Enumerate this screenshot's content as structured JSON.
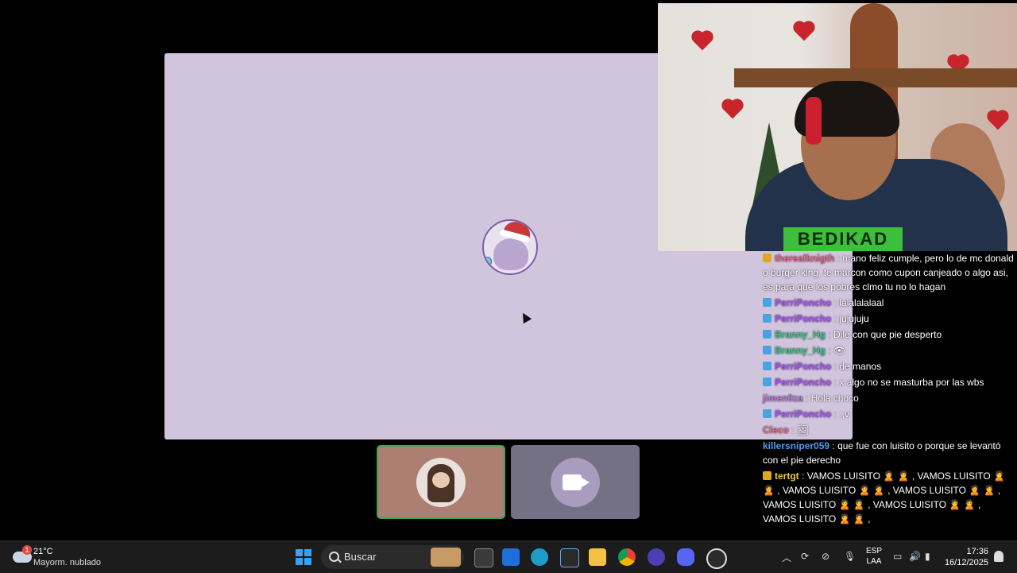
{
  "chat": {
    "messages": [
      {
        "user": "therealknigth",
        "user_color": "#e0688c",
        "badge": "gold",
        "text": "mano feliz cumple, pero lo de mc donald o burger king, te marcon como cupon canjeado o algo asi, es para que los pobres clmo tu no lo hagan"
      },
      {
        "user": "PerriPoncho",
        "user_color": "#a855f7",
        "badge": "blue",
        "text": "lalalalalaal"
      },
      {
        "user": "PerriPoncho",
        "user_color": "#a855f7",
        "badge": "blue",
        "text": "jujujuju"
      },
      {
        "user": "Branny_Hg",
        "user_color": "#3ec58a",
        "badge": "blue",
        "text": "Dile con que pie desperto"
      },
      {
        "user": "Branny_Hg",
        "user_color": "#3ec58a",
        "badge": "blue",
        "text": "👁"
      },
      {
        "user": "PerriPoncho",
        "user_color": "#a855f7",
        "badge": "blue",
        "text": "de manos"
      },
      {
        "user": "PerriPoncho",
        "user_color": "#a855f7",
        "badge": "blue",
        "text": "x algo no se masturba por las wbs"
      },
      {
        "user": "jimen0za",
        "user_color": "#b07bd4",
        "badge": "",
        "text": "Hola choco"
      },
      {
        "user": "PerriPoncho",
        "user_color": "#a855f7",
        "badge": "blue",
        "text": ":,v"
      },
      {
        "user": "Cleco",
        "user_color": "#e86a8a",
        "badge": "",
        "text": "🖼"
      },
      {
        "user": "killersniper059",
        "user_color": "#4f9df0",
        "badge": "",
        "text": "que fue con luisito o porque se levantó con el pie derecho"
      },
      {
        "user": "tertgt",
        "user_color": "#f0c64a",
        "badge": "gold",
        "text": "VAMOS LUISITO 🙎 🙎 , VAMOS LUISITO 🙎 🙎 , VAMOS LUISITO 🙎 🙎 , VAMOS LUISITO 🙎 🙎 , VAMOS LUISITO 🙎 🙎 , VAMOS LUISITO 🙎 🙎 , VAMOS LUISITO 🙎 🙎 ,"
      }
    ]
  },
  "webcam": {
    "shirt_text": "BEDIKAD"
  },
  "tiles": {
    "speaking_border_color": "#3ba55c"
  },
  "taskbar": {
    "weather_temp": "21°C",
    "weather_desc": "Mayorm. nublado",
    "weather_badge": "1",
    "search_label": "Buscar",
    "lang_top": "ESP",
    "lang_bottom": "LAA",
    "time": "17:36",
    "date": "16/12/2025",
    "apps": [
      "stickers-app",
      "task-view",
      "outlook-app",
      "edge-browser",
      "microsoft-store",
      "file-explorer",
      "chrome-browser",
      "app-o",
      "discord-app",
      "obs-app"
    ]
  }
}
